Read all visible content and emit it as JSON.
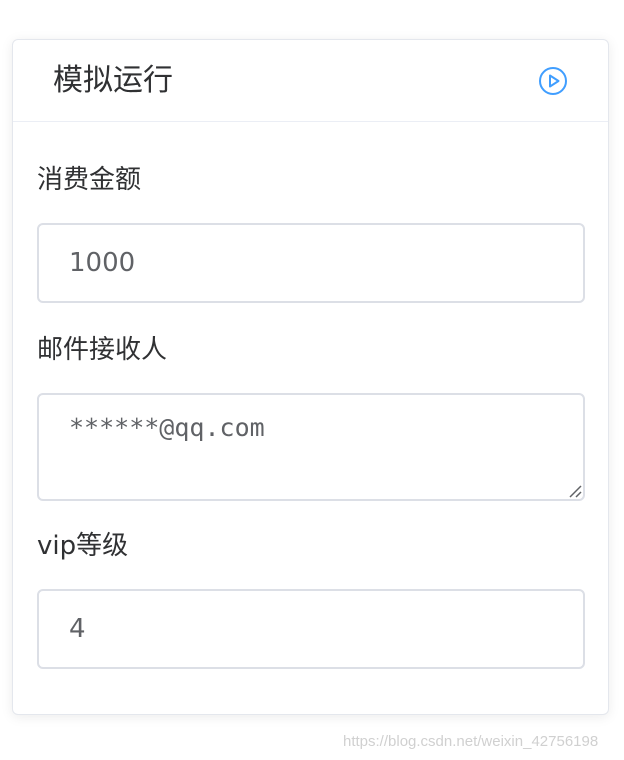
{
  "card": {
    "title": "模拟运行",
    "run_icon": "play-circle-icon"
  },
  "form": {
    "amount": {
      "label": "消费金额",
      "value": "1000"
    },
    "recipient": {
      "label": "邮件接收人",
      "value": "******@qq.com"
    },
    "vip": {
      "label": "vip等级",
      "value": "4"
    }
  },
  "watermark": "https://blog.csdn.net/weixin_42756198",
  "colors": {
    "accent": "#409eff",
    "border": "#dcdfe6",
    "text": "#303133",
    "input_text": "#606266"
  }
}
